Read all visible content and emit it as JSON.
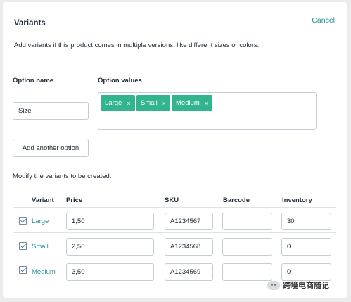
{
  "header": {
    "title": "Variants",
    "cancel_label": "Cancel",
    "description": "Add variants if this product comes in multiple versions, like different sizes or colors."
  },
  "options": {
    "name_label": "Option name",
    "values_label": "Option values",
    "name_value": "Size",
    "values": [
      "Large",
      "Small",
      "Medium"
    ],
    "remove_glyph": "×",
    "add_another_label": "Add another option"
  },
  "variants": {
    "intro": "Modify the variants to be created:",
    "columns": [
      "Variant",
      "Price",
      "SKU",
      "Barcode",
      "Inventory"
    ],
    "rows": [
      {
        "checked": true,
        "name": "Large",
        "price": "1,50",
        "sku": "A1234567",
        "barcode": "",
        "inventory": "30"
      },
      {
        "checked": true,
        "name": "Small",
        "price": "2,50",
        "sku": "A1234568",
        "barcode": "",
        "inventory": "0"
      },
      {
        "checked": true,
        "name": "Medium",
        "price": "3,50",
        "sku": "A1234569",
        "barcode": "",
        "inventory": "0"
      }
    ]
  },
  "watermark": {
    "text": "跨境电商随记",
    "icon": "wechat-icon"
  },
  "colors": {
    "accent": "#24909e",
    "tag": "#32b58e",
    "checkbox": "#2b73c2"
  }
}
